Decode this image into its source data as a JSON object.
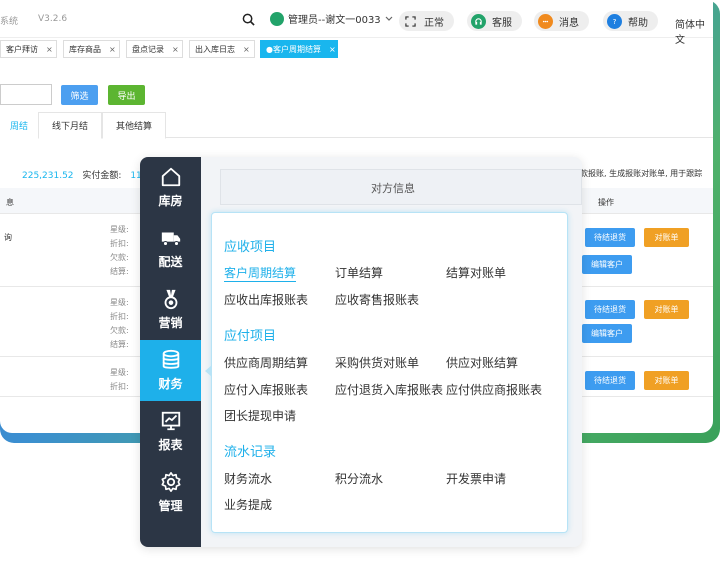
{
  "app": {
    "system_suffix": "系统",
    "version": "V3.2.6"
  },
  "topbar": {
    "user_label": "管理员--谢文一0033",
    "mode_label": "正常",
    "service_label": "客服",
    "message_label": "消息",
    "help_label": "帮助",
    "lang_label": "简体中文"
  },
  "tabs": [
    {
      "label": "客户拜访"
    },
    {
      "label": "库存商品"
    },
    {
      "label": "盘点记录"
    },
    {
      "label": "出入库日志"
    },
    {
      "label": "●客户周期结算"
    }
  ],
  "tab_close": "×",
  "filters": {
    "filter_label": "筛选",
    "export_label": "导出"
  },
  "subtabs": [
    "周结",
    "线下月结",
    "其他结算"
  ],
  "summary": {
    "amount": "225,231.52",
    "paid_label": "实付金额:",
    "paid_value": "11"
  },
  "notice": "款报账, 生成报账对账单, 用于跟踪",
  "table": {
    "head_left": "息",
    "head_right": "操作",
    "rows": [
      {
        "left": "询",
        "labels": [
          "星级:",
          "折扣:",
          "欠款:",
          "结算:"
        ],
        "btn1": "待结退货",
        "btn2": "对账单",
        "btn3": "编辑客户"
      },
      {
        "left": "",
        "labels": [
          "星级:",
          "折扣:",
          "欠款:",
          "结算:"
        ],
        "btn1": "待结退货",
        "btn2": "对账单",
        "btn3": "编辑客户"
      },
      {
        "left": "",
        "labels": [
          "星级:",
          "折扣:"
        ],
        "btn1": "待结退货",
        "btn2": "对账单"
      }
    ]
  },
  "panel": {
    "header": "对方信息"
  },
  "sidebar": [
    {
      "label": "库房",
      "icon": "home-icon"
    },
    {
      "label": "配送",
      "icon": "truck-icon"
    },
    {
      "label": "营销",
      "icon": "medal-icon"
    },
    {
      "label": "财务",
      "icon": "database-icon"
    },
    {
      "label": "报表",
      "icon": "chart-icon"
    },
    {
      "label": "管理",
      "icon": "gear-icon"
    }
  ],
  "submenu": {
    "receivable": {
      "title": "应收项目",
      "items": [
        "客户周期结算",
        "订单结算",
        "结算对账单",
        "应收出库报账表",
        "应收寄售报账表"
      ]
    },
    "payable": {
      "title": "应付项目",
      "items": [
        "供应商周期结算",
        "采购供货对账单",
        "供应对账结算",
        "应付入库报账表",
        "应付退货入库报账表",
        "应付供应商报账表",
        "团长提现申请"
      ]
    },
    "flow": {
      "title": "流水记录",
      "items": [
        "财务流水",
        "积分流水",
        "开发票申请",
        "业务提成"
      ]
    }
  },
  "colors": {
    "accent": "#1eb0ea",
    "sidebar": "#2c3645",
    "orange": "#f0a024",
    "green": "#5cb531"
  }
}
